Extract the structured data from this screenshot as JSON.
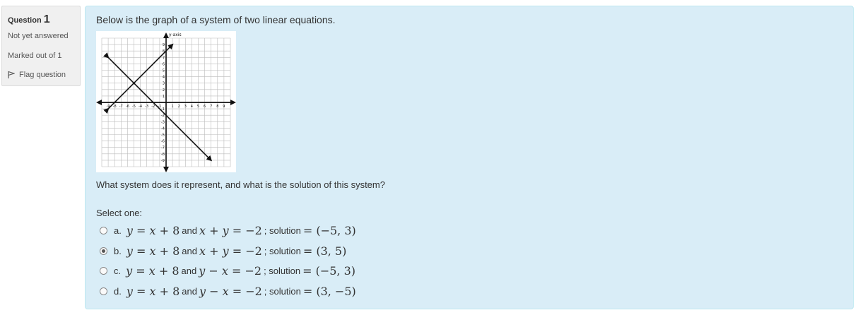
{
  "info": {
    "question_label": "Question",
    "question_number": "1",
    "state": "Not yet answered",
    "grade": "Marked out of 1",
    "flag_label": "Flag question"
  },
  "question": {
    "intro": "Below is the graph of a system of two linear equations.",
    "prompt": "What system does it represent, and what is the solution of this system?",
    "select_label": "Select one:",
    "graph": {
      "x_axis_label": "x-axis",
      "y_axis_label": "y-axis",
      "x_range": [
        -10,
        10
      ],
      "y_range": [
        -10,
        10
      ],
      "lines": [
        {
          "equation": "y = x + 8",
          "from": [
            -9,
            -1
          ],
          "to": [
            1,
            9
          ]
        },
        {
          "equation": "x + y = -2",
          "from": [
            -9,
            7
          ],
          "to": [
            7,
            -9
          ]
        }
      ]
    },
    "options": [
      {
        "letter": "a.",
        "and": "and",
        "solution_label": "; solution",
        "eq1": "y = x + 8",
        "eq2": "x + y = −2",
        "solution": "(−5, 3)",
        "selected": false
      },
      {
        "letter": "b.",
        "and": "and",
        "solution_label": "; solution",
        "eq1": "y = x + 8",
        "eq2": "x + y = −2",
        "solution": "(3, 5)",
        "selected": true
      },
      {
        "letter": "c.",
        "and": "and",
        "solution_label": "; solution",
        "eq1": "y = x + 8",
        "eq2": "y − x = −2",
        "solution": "(−5, 3)",
        "selected": false
      },
      {
        "letter": "d.",
        "and": "and",
        "solution_label": "; solution",
        "eq1": "y = x + 8",
        "eq2": "y − x = −2",
        "solution": "(3, −5)",
        "selected": false
      }
    ]
  }
}
